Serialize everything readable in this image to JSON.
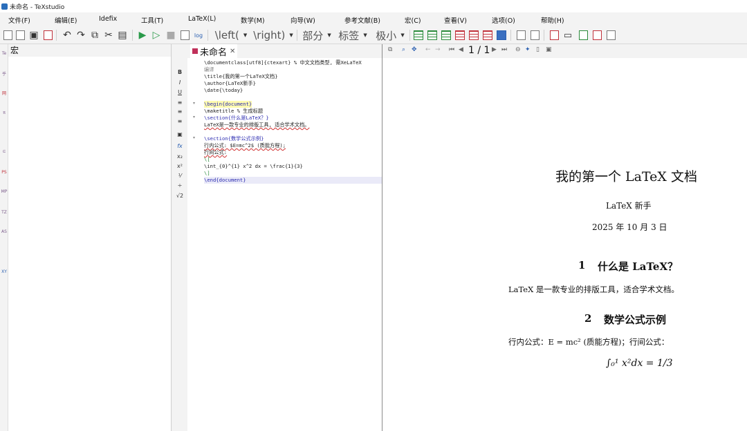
{
  "window": {
    "title": "未命名 - TeXstudio"
  },
  "menu": [
    "文件(F)",
    "编辑(E)",
    "Idefix",
    "工具(T)",
    "LaTeX(L)",
    "数学(M)",
    "向导(W)",
    "参考文献(B)",
    "宏(C)",
    "查看(V)",
    "选项(O)",
    "帮助(H)"
  ],
  "toolbar": {
    "left_combo": "\\left(",
    "right_combo": "\\right)",
    "section_combo": "部分",
    "label_combo": "标签",
    "size_combo": "极小"
  },
  "left_strip_labels": [
    "Te",
    "乎",
    "网",
    "π",
    "",
    "⊆",
    "PS",
    "MP",
    "TZ",
    "AS",
    "",
    "XY"
  ],
  "macro_panel": {
    "title": "宏"
  },
  "format_strip": [
    "B",
    "I",
    "U",
    "",
    "",
    "",
    "",
    "fx",
    "x₂",
    "x²",
    "",
    "",
    "√2"
  ],
  "editor": {
    "tab_name": "未命名",
    "lines": [
      {
        "fold": "",
        "text": "\\documentclass[utf8]{ctexart} % 中文文档类型, 需XeLaTeX"
      },
      {
        "fold": "",
        "text": "编译"
      },
      {
        "fold": "",
        "text": "\\title{我的第一个LaTeX文档}"
      },
      {
        "fold": "",
        "text": "\\author{LaTeX新手}"
      },
      {
        "fold": "",
        "text": "\\date{\\today}"
      },
      {
        "fold": "",
        "text": ""
      },
      {
        "fold": "▾",
        "text": "\\begin{document}"
      },
      {
        "fold": "",
        "text": "    \\maketitle % 生成标题"
      },
      {
        "fold": "▾",
        "text": "    \\section{什么是LaTeX？}"
      },
      {
        "fold": "",
        "text": "    LaTeX是一款专业的排版工具, 适合学术文档。"
      },
      {
        "fold": "",
        "text": ""
      },
      {
        "fold": "▾",
        "text": "    \\section{数学公式示例}"
      },
      {
        "fold": "",
        "text": "    行内公式: $E=mc^2$ (质能方程);"
      },
      {
        "fold": "",
        "text": "    行间公式:"
      },
      {
        "fold": "",
        "text": "    \\["
      },
      {
        "fold": "",
        "text": "    \\int_{0}^{1} x^2 dx = \\frac{1}{3}"
      },
      {
        "fold": "",
        "text": "    \\]"
      },
      {
        "fold": "",
        "text": "\\end{document}"
      }
    ]
  },
  "viewer": {
    "page_indicator": "1 / 1",
    "doc_title": "我的第一个 LaTeX 文档",
    "doc_author": "LaTeX 新手",
    "doc_date": "2025 年 10 月 3 日",
    "section1_num": "1",
    "section1_title": "什么是 LaTeX？",
    "section1_body": "LaTeX 是一款专业的排版工具，适合学术文档。",
    "section2_num": "2",
    "section2_title": "数学公式示例",
    "section2_body": "行内公式：E = mc² (质能方程)；行间公式：",
    "equation": "∫₀¹ x²dx = 1/3"
  }
}
